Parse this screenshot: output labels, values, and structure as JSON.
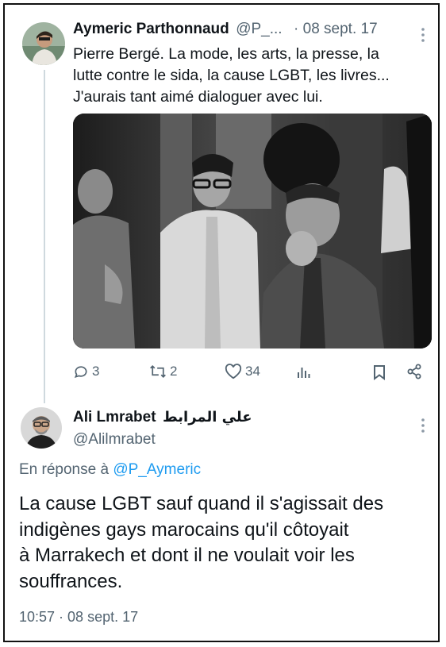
{
  "tweet1": {
    "author_name": "Aymeric Parthonnaud",
    "handle": "@P_...",
    "date": "· 08 sept. 17",
    "text_lines": [
      "Pierre Bergé. La mode, les arts, la presse, la",
      "lutte contre le sida, la cause LGBT, les livres...",
      "J'aurais tant aimé dialoguer avec lui."
    ],
    "actions": {
      "replies": "3",
      "retweets": "2",
      "likes": "34"
    }
  },
  "tweet2": {
    "author_name": "Ali Lmrabet",
    "author_name_ar": "علي المرابط",
    "handle": "@Alilmrabet",
    "reply_prefix": "En réponse à ",
    "reply_mention": "@P_Aymeric",
    "text_lines": [
      "La cause LGBT sauf quand il s'agissait des",
      "indigènes gays marocains qu'il côtoyait",
      "à Marrakech et dont il ne voulait voir les",
      "souffrances."
    ],
    "timestamp": "10:57 · 08 sept. 17"
  },
  "colors": {
    "text": "#0f1419",
    "muted": "#536471",
    "link": "#1d9bf0",
    "thread": "#cfd9de"
  },
  "icons": [
    "reply-icon",
    "retweet-icon",
    "like-icon",
    "views-icon",
    "bookmark-icon",
    "share-icon",
    "more-icon"
  ]
}
